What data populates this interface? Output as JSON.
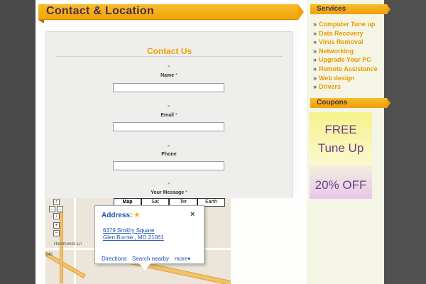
{
  "page_title": "Contact & Location",
  "form": {
    "heading": "Contact Us",
    "marker": "»",
    "required_mark": "*",
    "fields": [
      {
        "label": "Name",
        "required": true
      },
      {
        "label": "Email",
        "required": true
      },
      {
        "label": "Phone",
        "required": false
      },
      {
        "label": "Your Message",
        "required": true
      }
    ]
  },
  "sidebar": {
    "services_title": "Services",
    "services": [
      "Computer Tune up",
      "Data Recovery",
      "Virus Removal",
      "Networking",
      "Upgrade Your PC",
      "Remote Assistance",
      "Web design",
      "Drivers"
    ],
    "coupons_title": "Coupons",
    "coupon_1": [
      "FREE",
      "Tune Up"
    ],
    "coupon_2": [
      "20% OFF"
    ]
  },
  "map": {
    "type_buttons": [
      "Map",
      "Sat",
      "Ter",
      "Earth"
    ],
    "selected_type": "Map",
    "zoom_icons": [
      "arrow-up-icon",
      "arrow-left-icon",
      "arrow-right-icon",
      "arrow-down-icon",
      "zoom-plus-icon",
      "zoom-minus-icon"
    ],
    "street_label": "Hammonds Ln",
    "shield_label": "648",
    "infowindow": {
      "title": "Address:",
      "address_line_1": "6379 Smithy Square",
      "address_line_2": "Glen Burnie , MD 21061",
      "links": [
        "Directions",
        "Search nearby",
        "more"
      ]
    }
  },
  "colors": {
    "accent": "#f0a307",
    "title_text": "#4a2d52",
    "link_blue": "#1a4fb5",
    "service_orange": "#e89a00"
  }
}
